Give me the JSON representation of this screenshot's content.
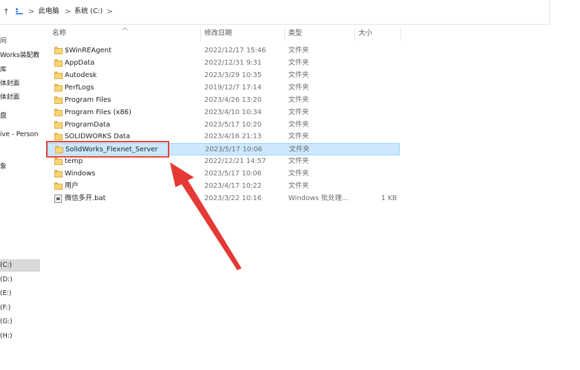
{
  "address_bar": {
    "up_icon": "arrow-up-icon",
    "crumbs": [
      "此电脑",
      "系统 (C:)"
    ],
    "separator": ">"
  },
  "nav_pane": {
    "items": [
      {
        "label": "问",
        "selected": false
      },
      {
        "label": "Works装配教",
        "selected": false
      },
      {
        "label": "库",
        "selected": false
      },
      {
        "label": "体封面",
        "selected": false
      },
      {
        "label": "体封面",
        "selected": false
      },
      {
        "label": "盘",
        "selected": false
      },
      {
        "label": "ive - Person",
        "selected": false
      },
      {
        "label": "象",
        "selected": false
      },
      {
        "label": "(C:)",
        "selected": true
      },
      {
        "label": "(D:)",
        "selected": false
      },
      {
        "label": "(E:)",
        "selected": false
      },
      {
        "label": "(F:)",
        "selected": false
      },
      {
        "label": "(G:)",
        "selected": false
      },
      {
        "label": "(H:)",
        "selected": false
      }
    ]
  },
  "columns": {
    "name": "名称",
    "date": "修改日期",
    "type": "类型",
    "size": "大小"
  },
  "files": [
    {
      "name": "$WinREAgent",
      "date": "2022/12/17 15:46",
      "type": "文件夹",
      "size": "",
      "icon": "folder-icon"
    },
    {
      "name": "AppData",
      "date": "2022/12/31 9:31",
      "type": "文件夹",
      "size": "",
      "icon": "folder-icon"
    },
    {
      "name": "Autodesk",
      "date": "2023/3/29 10:35",
      "type": "文件夹",
      "size": "",
      "icon": "folder-icon"
    },
    {
      "name": "PerfLogs",
      "date": "2019/12/7 17:14",
      "type": "文件夹",
      "size": "",
      "icon": "folder-icon"
    },
    {
      "name": "Program Files",
      "date": "2023/4/26 13:20",
      "type": "文件夹",
      "size": "",
      "icon": "folder-icon"
    },
    {
      "name": "Program Files (x86)",
      "date": "2023/4/10 10:34",
      "type": "文件夹",
      "size": "",
      "icon": "folder-icon"
    },
    {
      "name": "ProgramData",
      "date": "2023/5/17 10:20",
      "type": "文件夹",
      "size": "",
      "icon": "folder-icon"
    },
    {
      "name": "SOLIDWORKS Data",
      "date": "2023/4/16 21:13",
      "type": "文件夹",
      "size": "",
      "icon": "folder-icon"
    },
    {
      "name": "SolidWorks_Flexnet_Server",
      "date": "2023/5/17 10:06",
      "type": "文件夹",
      "size": "",
      "icon": "folder-icon",
      "selected": true
    },
    {
      "name": "temp",
      "date": "2022/12/21 14:57",
      "type": "文件夹",
      "size": "",
      "icon": "folder-icon"
    },
    {
      "name": "Windows",
      "date": "2023/5/17 10:06",
      "type": "文件夹",
      "size": "",
      "icon": "folder-icon"
    },
    {
      "name": "用户",
      "date": "2023/4/17 10:22",
      "type": "文件夹",
      "size": "",
      "icon": "folder-icon"
    },
    {
      "name": "微信多开.bat",
      "date": "2023/3/22 10:16",
      "type": "Windows 批处理...",
      "size": "1 KB",
      "icon": "batch-file-icon"
    }
  ],
  "annotation": {
    "highlight_color": "#e53935",
    "arrow_color": "#e53935"
  }
}
